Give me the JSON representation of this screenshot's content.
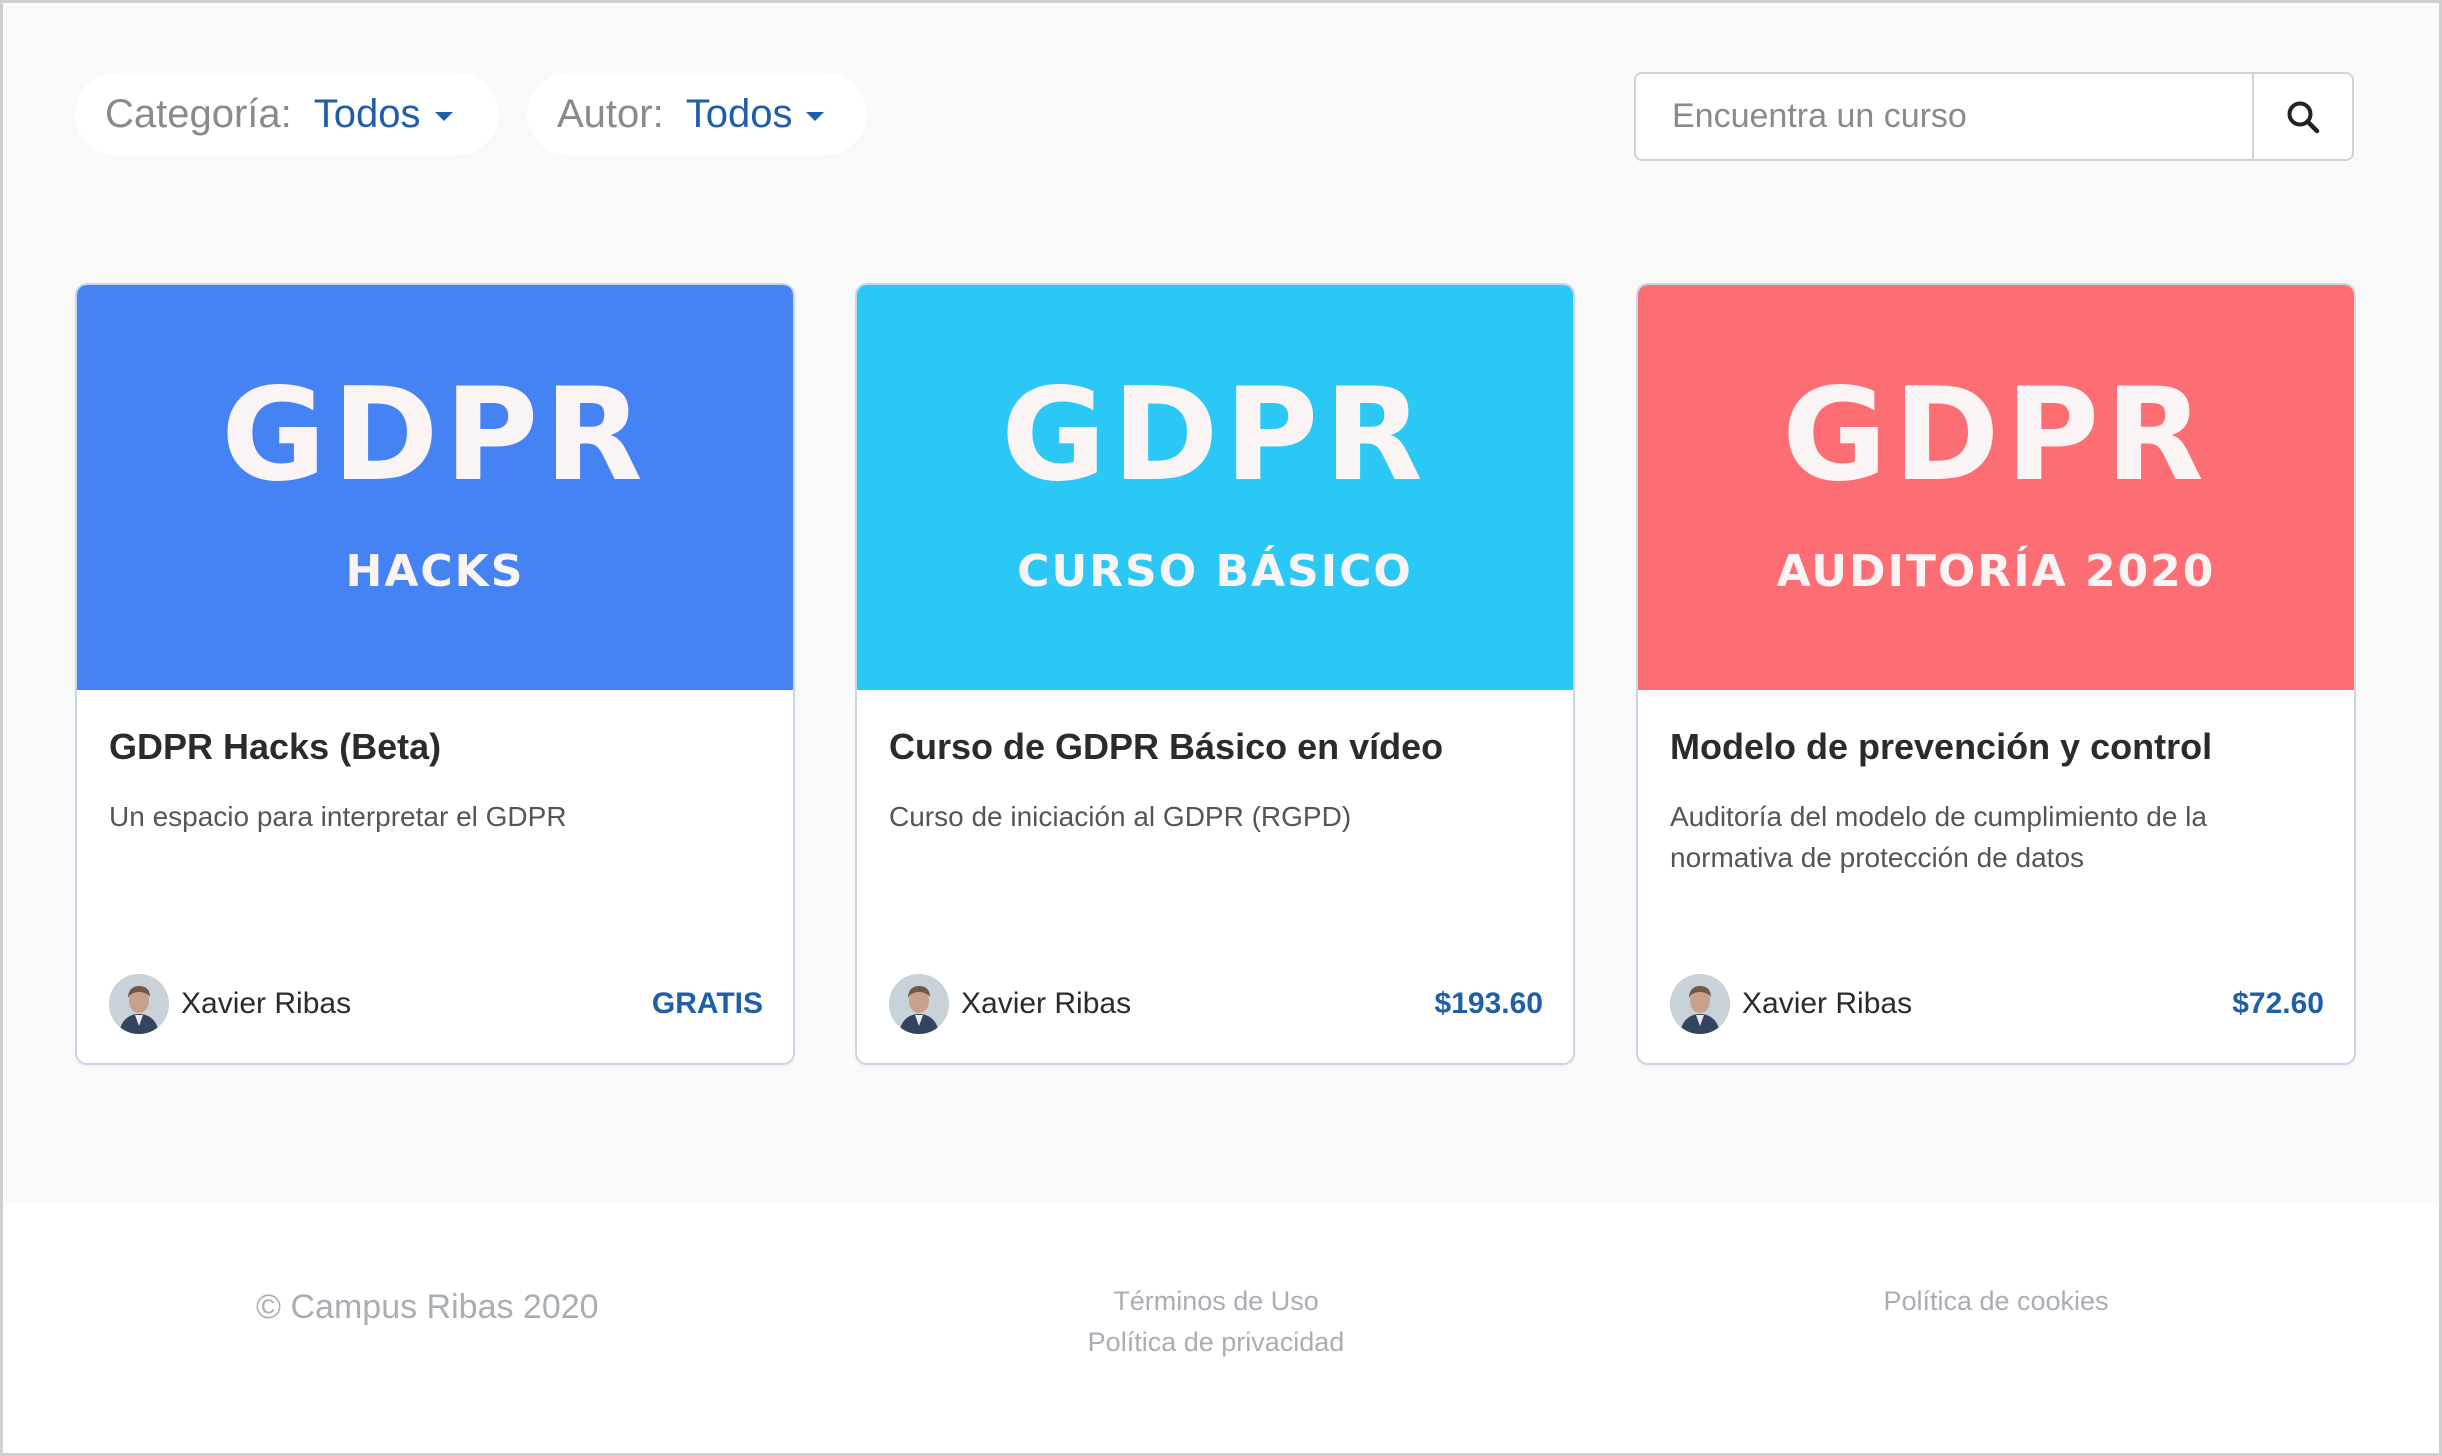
{
  "filters": {
    "category": {
      "label": "Categoría:",
      "value": "Todos"
    },
    "author": {
      "label": "Autor:",
      "value": "Todos"
    }
  },
  "search": {
    "placeholder": "Encuentra un curso",
    "icon": "search-icon"
  },
  "courses": [
    {
      "banner_big": "GDPR",
      "banner_sub": "HACKS",
      "banner_color": "#4582f3",
      "title": "GDPR Hacks (Beta)",
      "description": "Un espacio para interpretar el GDPR",
      "author": "Xavier Ribas",
      "price": "GRATIS"
    },
    {
      "banner_big": "GDPR",
      "banner_sub": "CURSO BÁSICO",
      "banner_color": "#2bc8f5",
      "title": "Curso de GDPR Básico en vídeo",
      "description": "Curso de iniciación al GDPR (RGPD)",
      "author": "Xavier Ribas",
      "price": "$193.60"
    },
    {
      "banner_big": "GDPR",
      "banner_sub": "AUDITORÍA 2020",
      "banner_color": "#fc6e73",
      "title": "Modelo de prevención y control",
      "description": "Auditoría del modelo de cumplimiento de la normativa de protección de datos",
      "author": "Xavier Ribas",
      "price": "$72.60"
    }
  ],
  "footer": {
    "copyright": "© Campus Ribas 2020",
    "terms": "Términos de Uso",
    "privacy": "Política de privacidad",
    "cookies": "Política de cookies"
  },
  "colors": {
    "accent": "#1f5ea8",
    "background": "#f9f9f9",
    "muted": "#a9aeb4"
  }
}
